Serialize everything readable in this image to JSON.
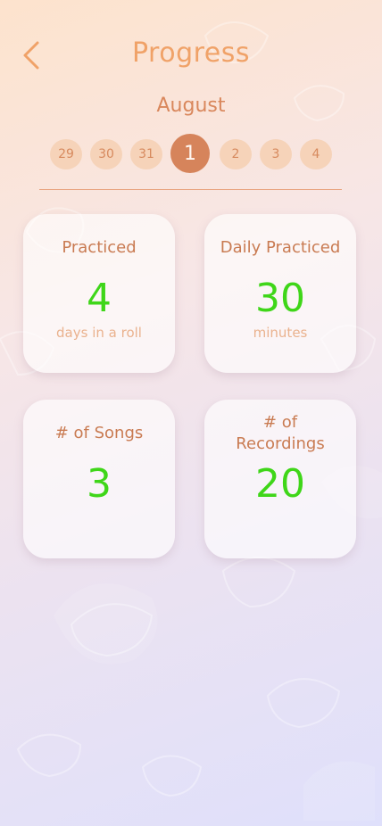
{
  "header": {
    "title": "Progress",
    "back_icon": "chevron-left-icon"
  },
  "calendar": {
    "month": "August",
    "days": [
      {
        "label": "29",
        "selected": false
      },
      {
        "label": "30",
        "selected": false
      },
      {
        "label": "31",
        "selected": false
      },
      {
        "label": "1",
        "selected": true
      },
      {
        "label": "2",
        "selected": false
      },
      {
        "label": "3",
        "selected": false
      },
      {
        "label": "4",
        "selected": false
      }
    ]
  },
  "stats": {
    "practiced": {
      "title": "Practiced",
      "value": "4",
      "unit": "days in a roll"
    },
    "daily": {
      "title": "Daily Practiced",
      "value": "30",
      "unit": "minutes"
    },
    "songs": {
      "title": "# of Songs",
      "value": "3"
    },
    "recordings": {
      "title_line1": "# of",
      "title_line2": "Recordings",
      "value": "20"
    }
  },
  "colors": {
    "accent": "#d6845b",
    "title": "#f0a268",
    "value": "#3fd619",
    "day_bg": "#f6d3b9"
  }
}
